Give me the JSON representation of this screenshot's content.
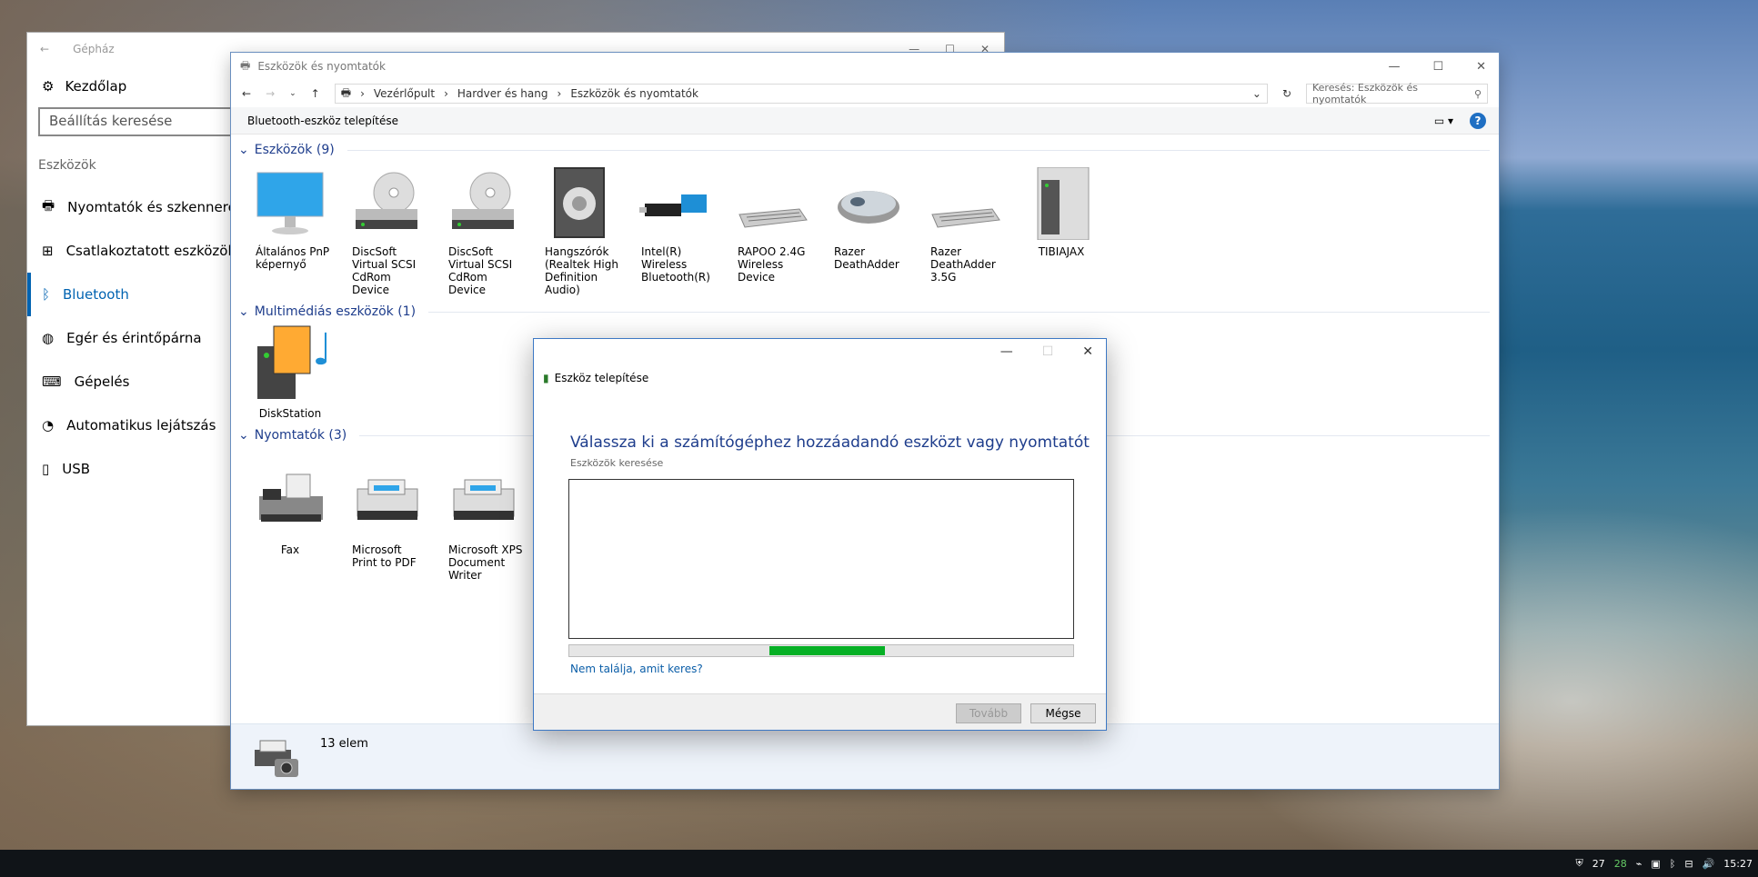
{
  "settings": {
    "title": "Gépház",
    "home": "Kezdőlap",
    "search_placeholder": "Beállítás keresése",
    "category": "Eszközök",
    "items": [
      {
        "label": "Nyomtatók és szkennerek",
        "icon": "printer-icon"
      },
      {
        "label": "Csatlakoztatott eszközök",
        "icon": "connected-devices-icon"
      },
      {
        "label": "Bluetooth",
        "icon": "bluetooth-icon",
        "active": true
      },
      {
        "label": "Egér és érintőpárna",
        "icon": "mouse-icon"
      },
      {
        "label": "Gépelés",
        "icon": "keyboard-icon"
      },
      {
        "label": "Automatikus lejátszás",
        "icon": "autoplay-icon"
      },
      {
        "label": "USB",
        "icon": "usb-icon"
      }
    ]
  },
  "explorer": {
    "title": "Eszközök és nyomtatók",
    "breadcrumb": [
      "Vezérlőpult",
      "Hardver és hang",
      "Eszközök és nyomtatók"
    ],
    "search_placeholder": "Keresés: Eszközök és nyomtatók",
    "command": "Bluetooth-eszköz telepítése",
    "groups": {
      "devices": {
        "title": "Eszközök (9)",
        "items": [
          "Általános PnP képernyő",
          "DiscSoft Virtual SCSI CdRom Device",
          "DiscSoft Virtual SCSI CdRom Device",
          "Hangszórók (Realtek High Definition Audio)",
          "Intel(R) Wireless Bluetooth(R)",
          "RAPOO 2.4G Wireless Device",
          "Razer DeathAdder",
          "Razer DeathAdder 3.5G",
          "TIBIAJAX"
        ]
      },
      "multimedia": {
        "title": "Multimédiás eszközök (1)",
        "items": [
          "DiskStation"
        ]
      },
      "printers": {
        "title": "Nyomtatók (3)",
        "items": [
          "Fax",
          "Microsoft Print to PDF",
          "Microsoft XPS Document Writer"
        ]
      }
    },
    "status_count": "13 elem"
  },
  "dialog": {
    "title": "Eszköz telepítése",
    "heading": "Válassza ki a számítógéphez hozzáadandó eszközt vagy nyomtatót",
    "subheading": "Eszközök keresése",
    "link": "Nem találja, amit keres?",
    "next": "Tovább",
    "cancel": "Mégse"
  },
  "taskbar": {
    "tray1": "27",
    "tray2": "28",
    "time": "15:27"
  }
}
